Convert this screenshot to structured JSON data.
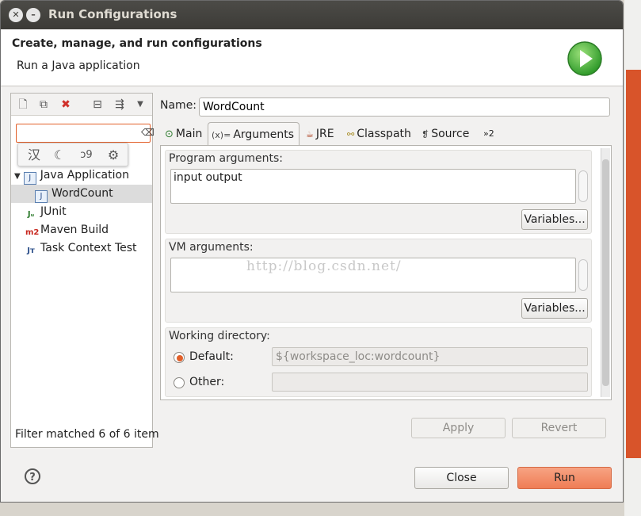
{
  "window": {
    "title": "Run Configurations"
  },
  "header": {
    "title": "Create, manage, and run configurations",
    "subtitle": "Run a Java application"
  },
  "left": {
    "filter_value": "",
    "ime_icons": [
      "汉",
      "☾",
      "ↄ9",
      "⚙"
    ],
    "tree": [
      {
        "label": "Java Application"
      },
      {
        "label": "WordCount"
      },
      {
        "label": "JUnit"
      },
      {
        "label": "Maven Build"
      },
      {
        "label": "Task Context Test"
      }
    ],
    "status": "Filter matched 6 of 6 item"
  },
  "form": {
    "name_label": "Name:",
    "name_value": "WordCount",
    "tabs": [
      {
        "label": "Main"
      },
      {
        "label": "Arguments"
      },
      {
        "label": "JRE"
      },
      {
        "label": "Classpath"
      },
      {
        "label": "Source"
      },
      {
        "label": "»2"
      }
    ],
    "program_args": {
      "label": "Program arguments:",
      "value": "input output",
      "button": "Variables..."
    },
    "vm_args": {
      "label": "VM arguments:",
      "value": "",
      "button": "Variables..."
    },
    "working_dir": {
      "label": "Working directory:",
      "default_label": "Default:",
      "default_value": "${workspace_loc:wordcount}",
      "other_label": "Other:",
      "other_value": ""
    },
    "watermark": "http://blog.csdn.net/"
  },
  "buttons": {
    "apply": "Apply",
    "revert": "Revert",
    "close": "Close",
    "run": "Run"
  },
  "colors": {
    "accent": "#e2602a",
    "run_button": "#f28b68",
    "titlebar": "#3c3b37"
  }
}
